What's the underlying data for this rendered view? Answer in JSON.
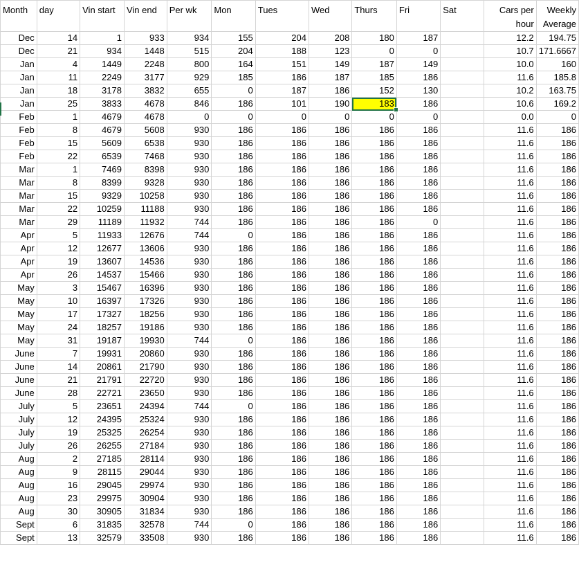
{
  "headers": [
    "Month",
    "day",
    "Vin start",
    "Vin end",
    "Per wk",
    "Mon",
    "Tues",
    "Wed",
    "Thurs",
    "Fri",
    "Sat",
    "Cars per hour",
    "Weekly Average"
  ],
  "selected": {
    "row": 5,
    "col": 8,
    "highlight": "#ffff00",
    "border": "#217346"
  },
  "rows": [
    [
      "Dec",
      "14",
      "1",
      "933",
      "934",
      "155",
      "204",
      "208",
      "180",
      "187",
      "",
      "12.2",
      "194.75"
    ],
    [
      "Dec",
      "21",
      "934",
      "1448",
      "515",
      "204",
      "188",
      "123",
      "0",
      "0",
      "",
      "10.7",
      "171.6667"
    ],
    [
      "Jan",
      "4",
      "1449",
      "2248",
      "800",
      "164",
      "151",
      "149",
      "187",
      "149",
      "",
      "10.0",
      "160"
    ],
    [
      "Jan",
      "11",
      "2249",
      "3177",
      "929",
      "185",
      "186",
      "187",
      "185",
      "186",
      "",
      "11.6",
      "185.8"
    ],
    [
      "Jan",
      "18",
      "3178",
      "3832",
      "655",
      "0",
      "187",
      "186",
      "152",
      "130",
      "",
      "10.2",
      "163.75"
    ],
    [
      "Jan",
      "25",
      "3833",
      "4678",
      "846",
      "186",
      "101",
      "190",
      "183",
      "186",
      "",
      "10.6",
      "169.2"
    ],
    [
      "Feb",
      "1",
      "4679",
      "4678",
      "0",
      "0",
      "0",
      "0",
      "0",
      "0",
      "",
      "0.0",
      "0"
    ],
    [
      "Feb",
      "8",
      "4679",
      "5608",
      "930",
      "186",
      "186",
      "186",
      "186",
      "186",
      "",
      "11.6",
      "186"
    ],
    [
      "Feb",
      "15",
      "5609",
      "6538",
      "930",
      "186",
      "186",
      "186",
      "186",
      "186",
      "",
      "11.6",
      "186"
    ],
    [
      "Feb",
      "22",
      "6539",
      "7468",
      "930",
      "186",
      "186",
      "186",
      "186",
      "186",
      "",
      "11.6",
      "186"
    ],
    [
      "Mar",
      "1",
      "7469",
      "8398",
      "930",
      "186",
      "186",
      "186",
      "186",
      "186",
      "",
      "11.6",
      "186"
    ],
    [
      "Mar",
      "8",
      "8399",
      "9328",
      "930",
      "186",
      "186",
      "186",
      "186",
      "186",
      "",
      "11.6",
      "186"
    ],
    [
      "Mar",
      "15",
      "9329",
      "10258",
      "930",
      "186",
      "186",
      "186",
      "186",
      "186",
      "",
      "11.6",
      "186"
    ],
    [
      "Mar",
      "22",
      "10259",
      "11188",
      "930",
      "186",
      "186",
      "186",
      "186",
      "186",
      "",
      "11.6",
      "186"
    ],
    [
      "Mar",
      "29",
      "11189",
      "11932",
      "744",
      "186",
      "186",
      "186",
      "186",
      "0",
      "",
      "11.6",
      "186"
    ],
    [
      "Apr",
      "5",
      "11933",
      "12676",
      "744",
      "0",
      "186",
      "186",
      "186",
      "186",
      "",
      "11.6",
      "186"
    ],
    [
      "Apr",
      "12",
      "12677",
      "13606",
      "930",
      "186",
      "186",
      "186",
      "186",
      "186",
      "",
      "11.6",
      "186"
    ],
    [
      "Apr",
      "19",
      "13607",
      "14536",
      "930",
      "186",
      "186",
      "186",
      "186",
      "186",
      "",
      "11.6",
      "186"
    ],
    [
      "Apr",
      "26",
      "14537",
      "15466",
      "930",
      "186",
      "186",
      "186",
      "186",
      "186",
      "",
      "11.6",
      "186"
    ],
    [
      "May",
      "3",
      "15467",
      "16396",
      "930",
      "186",
      "186",
      "186",
      "186",
      "186",
      "",
      "11.6",
      "186"
    ],
    [
      "May",
      "10",
      "16397",
      "17326",
      "930",
      "186",
      "186",
      "186",
      "186",
      "186",
      "",
      "11.6",
      "186"
    ],
    [
      "May",
      "17",
      "17327",
      "18256",
      "930",
      "186",
      "186",
      "186",
      "186",
      "186",
      "",
      "11.6",
      "186"
    ],
    [
      "May",
      "24",
      "18257",
      "19186",
      "930",
      "186",
      "186",
      "186",
      "186",
      "186",
      "",
      "11.6",
      "186"
    ],
    [
      "May",
      "31",
      "19187",
      "19930",
      "744",
      "0",
      "186",
      "186",
      "186",
      "186",
      "",
      "11.6",
      "186"
    ],
    [
      "June",
      "7",
      "19931",
      "20860",
      "930",
      "186",
      "186",
      "186",
      "186",
      "186",
      "",
      "11.6",
      "186"
    ],
    [
      "June",
      "14",
      "20861",
      "21790",
      "930",
      "186",
      "186",
      "186",
      "186",
      "186",
      "",
      "11.6",
      "186"
    ],
    [
      "June",
      "21",
      "21791",
      "22720",
      "930",
      "186",
      "186",
      "186",
      "186",
      "186",
      "",
      "11.6",
      "186"
    ],
    [
      "June",
      "28",
      "22721",
      "23650",
      "930",
      "186",
      "186",
      "186",
      "186",
      "186",
      "",
      "11.6",
      "186"
    ],
    [
      "July",
      "5",
      "23651",
      "24394",
      "744",
      "0",
      "186",
      "186",
      "186",
      "186",
      "",
      "11.6",
      "186"
    ],
    [
      "July",
      "12",
      "24395",
      "25324",
      "930",
      "186",
      "186",
      "186",
      "186",
      "186",
      "",
      "11.6",
      "186"
    ],
    [
      "July",
      "19",
      "25325",
      "26254",
      "930",
      "186",
      "186",
      "186",
      "186",
      "186",
      "",
      "11.6",
      "186"
    ],
    [
      "July",
      "26",
      "26255",
      "27184",
      "930",
      "186",
      "186",
      "186",
      "186",
      "186",
      "",
      "11.6",
      "186"
    ],
    [
      "Aug",
      "2",
      "27185",
      "28114",
      "930",
      "186",
      "186",
      "186",
      "186",
      "186",
      "",
      "11.6",
      "186"
    ],
    [
      "Aug",
      "9",
      "28115",
      "29044",
      "930",
      "186",
      "186",
      "186",
      "186",
      "186",
      "",
      "11.6",
      "186"
    ],
    [
      "Aug",
      "16",
      "29045",
      "29974",
      "930",
      "186",
      "186",
      "186",
      "186",
      "186",
      "",
      "11.6",
      "186"
    ],
    [
      "Aug",
      "23",
      "29975",
      "30904",
      "930",
      "186",
      "186",
      "186",
      "186",
      "186",
      "",
      "11.6",
      "186"
    ],
    [
      "Aug",
      "30",
      "30905",
      "31834",
      "930",
      "186",
      "186",
      "186",
      "186",
      "186",
      "",
      "11.6",
      "186"
    ],
    [
      "Sept",
      "6",
      "31835",
      "32578",
      "744",
      "0",
      "186",
      "186",
      "186",
      "186",
      "",
      "11.6",
      "186"
    ],
    [
      "Sept",
      "13",
      "32579",
      "33508",
      "930",
      "186",
      "186",
      "186",
      "186",
      "186",
      "",
      "11.6",
      "186"
    ]
  ]
}
